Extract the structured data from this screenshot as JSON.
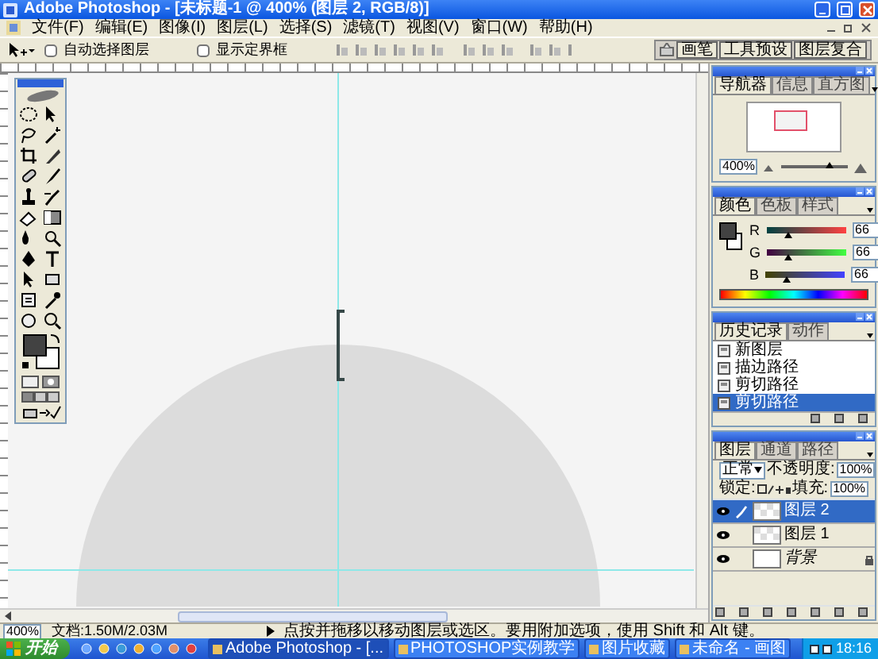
{
  "window": {
    "title": "Adobe Photoshop - [未标题-1 @ 400% (图层 2, RGB/8)]"
  },
  "menu": [
    "文件(F)",
    "编辑(E)",
    "图像(I)",
    "图层(L)",
    "选择(S)",
    "滤镜(T)",
    "视图(V)",
    "窗口(W)",
    "帮助(H)"
  ],
  "options_bar": {
    "checkboxes": [
      {
        "label": "自动选择图层",
        "checked": false
      },
      {
        "label": "显示定界框",
        "checked": false
      }
    ],
    "palette_well_tabs": [
      {
        "label": "画笔",
        "selected": false
      },
      {
        "label": "工具预设",
        "selected": false
      },
      {
        "label": "图层复合",
        "selected": false
      }
    ]
  },
  "navigator": {
    "tabs": [
      {
        "label": "导航器",
        "selected": true
      },
      {
        "label": "信息",
        "selected": false
      },
      {
        "label": "直方图",
        "selected": false
      }
    ],
    "zoom": "400%",
    "zoom_slider": {
      "level": 0.7
    }
  },
  "color": {
    "tabs": [
      {
        "label": "颜色",
        "selected": true
      },
      {
        "label": "色板",
        "selected": false
      },
      {
        "label": "样式",
        "selected": false
      }
    ],
    "channels": [
      {
        "name": "R",
        "value": "66",
        "level": 0.26
      },
      {
        "name": "G",
        "value": "66",
        "level": 0.26
      },
      {
        "name": "B",
        "value": "66",
        "level": 0.26
      }
    ]
  },
  "history": {
    "tabs": [
      {
        "label": "历史记录",
        "selected": true
      },
      {
        "label": "动作",
        "selected": false
      }
    ],
    "items": [
      {
        "label": "新图层",
        "selected": false
      },
      {
        "label": "描边路径",
        "selected": false
      },
      {
        "label": "剪切路径",
        "selected": false
      },
      {
        "label": "剪切路径",
        "selected": true
      }
    ]
  },
  "layers": {
    "tabs": [
      {
        "label": "图层",
        "selected": true
      },
      {
        "label": "通道",
        "selected": false
      },
      {
        "label": "路径",
        "selected": false
      }
    ],
    "blend_mode": "正常",
    "opacity_label": "不透明度:",
    "opacity": "100%",
    "lock_label": "锁定:",
    "fill_label": "填充:",
    "fill": "100%",
    "items": [
      {
        "name": "图层 2",
        "kind": "layer",
        "selected": true,
        "visible": true
      },
      {
        "name": "图层 1",
        "kind": "layer",
        "selected": false,
        "visible": true
      },
      {
        "name": "背景",
        "kind": "background",
        "selected": false,
        "visible": true
      }
    ]
  },
  "status_bar": {
    "zoom": "400%",
    "document": "文档:1.50M/2.03M",
    "hint": "点按并拖移以移动图层或选区。要用附加选项，使用 Shift 和 Alt 键。"
  },
  "taskbar": {
    "start": "开始",
    "items": [
      {
        "label": "Adobe Photoshop - [...",
        "selected": true
      },
      {
        "label": "PHOTOSHOP实例教学",
        "selected": false
      },
      {
        "label": "图片收藏",
        "selected": false
      },
      {
        "label": "未命名 - 画图",
        "selected": false
      }
    ],
    "clock": "18:16"
  }
}
